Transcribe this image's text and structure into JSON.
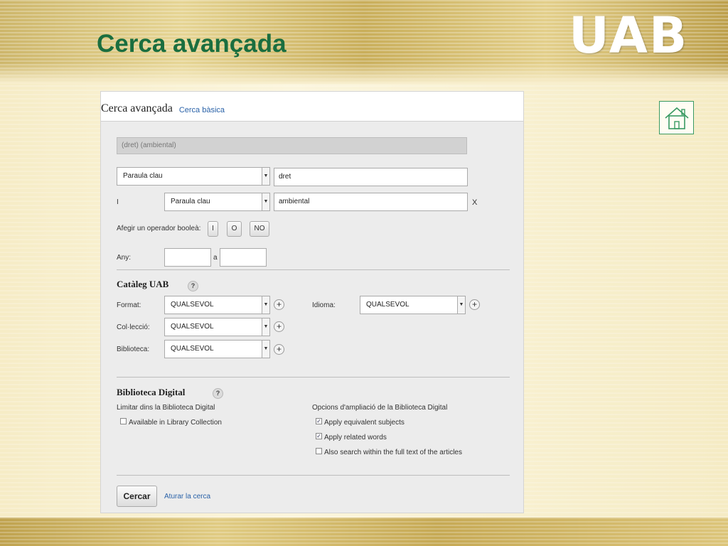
{
  "slide": {
    "title": "Cerca avançada",
    "logo_text": "UAB"
  },
  "panel": {
    "title": "Cerca avançada",
    "basic_link": "Cerca bàsica",
    "query_summary": "(dret) (ambiental)"
  },
  "rows": [
    {
      "operator": "",
      "field": "Paraula clau",
      "value": "dret"
    },
    {
      "operator": "I",
      "field": "Paraula clau",
      "value": "ambiental",
      "remove": "X"
    }
  ],
  "boolean": {
    "label": "Afegir un operador booleà:",
    "buttons": [
      "I",
      "O",
      "NO"
    ]
  },
  "year": {
    "label": "Any:",
    "from": "",
    "sep": "a",
    "to": ""
  },
  "catalog": {
    "title": "Catàleg UAB",
    "help": "?",
    "format_label": "Format:",
    "format_value": "QUALSEVOL",
    "collection_label": "Col·lecció:",
    "collection_value": "QUALSEVOL",
    "library_label": "Biblioteca:",
    "library_value": "QUALSEVOL",
    "language_label": "Idioma:",
    "language_value": "QUALSEVOL"
  },
  "digital": {
    "title": "Biblioteca Digital",
    "help": "?",
    "limit_label": "Limitar dins la Biblioteca Digital",
    "options_label": "Opcions d'ampliació de la Biblioteca Digital",
    "options": [
      {
        "label": "Available in Library Collection",
        "checked": false
      },
      {
        "label": "Apply equivalent subjects",
        "checked": true
      },
      {
        "label": "Apply related words",
        "checked": true
      },
      {
        "label": "Also search within the full text of the articles",
        "checked": false
      }
    ]
  },
  "actions": {
    "search": "Cercar",
    "stop": "Aturar la cerca"
  },
  "colors": {
    "title_green": "#1a6e3f",
    "link_blue": "#2a62a8"
  }
}
